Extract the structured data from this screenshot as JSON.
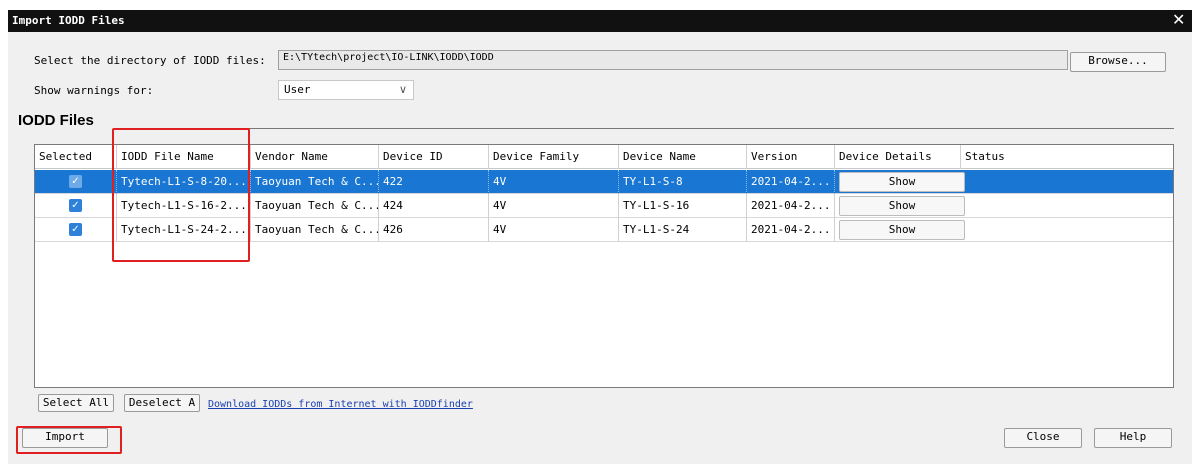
{
  "window": {
    "title": "Import IODD Files",
    "close_glyph": "✕"
  },
  "directory": {
    "label": "Select the directory of IODD files:",
    "path": "E:\\TYtech\\project\\IO-LINK\\IODD\\IODD",
    "browse_label": "Browse..."
  },
  "warnings": {
    "label": "Show warnings for:",
    "value": "User",
    "chevron": "∨"
  },
  "section_title": "IODD Files",
  "table": {
    "columns": [
      "Selected",
      "IODD File Name",
      "Vendor Name",
      "Device ID",
      "Device Family",
      "Device Name",
      "Version",
      "Device Details",
      "Status"
    ],
    "rows": [
      {
        "selected": "✓",
        "file": "Tytech-L1-S-8-20...",
        "vendor": "Taoyuan Tech & C...",
        "device_id": "422",
        "family": "4V",
        "name": "TY-L1-S-8",
        "version": "2021-04-2...",
        "details": "Show",
        "status": ""
      },
      {
        "selected": "✓",
        "file": "Tytech-L1-S-16-2...",
        "vendor": "Taoyuan Tech & C...",
        "device_id": "424",
        "family": "4V",
        "name": "TY-L1-S-16",
        "version": "2021-04-2...",
        "details": "Show",
        "status": ""
      },
      {
        "selected": "✓",
        "file": "Tytech-L1-S-24-2...",
        "vendor": "Taoyuan Tech & C...",
        "device_id": "426",
        "family": "4V",
        "name": "TY-L1-S-24",
        "version": "2021-04-2...",
        "details": "Show",
        "status": ""
      }
    ],
    "selected_row_color": "#1976d2"
  },
  "footer": {
    "select_all": "Select All",
    "deselect_all": "Deselect A",
    "download_link": "Download IODDs from Internet with IODDfinder",
    "import": "Import",
    "close": "Close",
    "help": "Help"
  },
  "colors": {
    "annotation": "#e02020",
    "title_bar": "#111111",
    "link": "#1a3fb0"
  }
}
